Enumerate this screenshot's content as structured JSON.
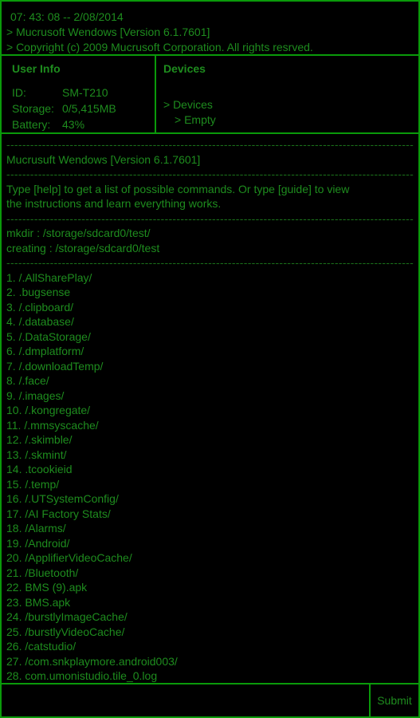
{
  "header": {
    "datetime": "07: 43: 08 -- 2/08/2014",
    "version_line": "> Mucrusoft Wendows [Version 6.1.7601]",
    "copyright_line": "> Copyright (c) 2009 Mucrusoft Corporation. All rights resrved."
  },
  "user_info": {
    "title": "User Info",
    "rows": [
      {
        "key": "ID:",
        "value": "SM-T210"
      },
      {
        "key": "Storage:",
        "value": "0/5,415MB"
      },
      {
        "key": "Battery:",
        "value": "43%"
      }
    ]
  },
  "devices": {
    "title": "Devices",
    "line1": "> Devices",
    "line2": "> Empty"
  },
  "console": {
    "separator": "-----------------------------------------------------------------------------------------------------------------------..",
    "version": "Mucrusuft Wendows [Version 6.1.7601]",
    "help_line1": "Type [help] to get a list of possible commands. Or type [guide] to view",
    "help_line2": "the instructions and learn everything works.",
    "mkdir_line": "mkdir : /storage/sdcard0/test/",
    "creating_line": "creating : /storage/sdcard0/test",
    "files": [
      "1.  /.AllSharePlay/",
      "2.  .bugsense",
      "3.  /.clipboard/",
      "4.  /.database/",
      "5.  /.DataStorage/",
      "6.  /.dmplatform/",
      "7.  /.downloadTemp/",
      "8.  /.face/",
      "9.  /.images/",
      "10.  /.kongregate/",
      "11.  /.mmsyscache/",
      "12.  /.skimble/",
      "13.  /.skmint/",
      "14.  .tcookieid",
      "15.  /.temp/",
      "16.  /.UTSystemConfig/",
      "17.  /AI Factory Stats/",
      "18.  /Alarms/",
      "19.  /Android/",
      "20.  /ApplifierVideoCache/",
      "21.  /Bluetooth/",
      "22.  BMS (9).apk",
      "23.  BMS.apk",
      "24.  /burstlyImageCache/",
      "25.  /burstlyVideoCache/",
      "26.  /catstudio/",
      "27.  /com.snkplaymore.android003/",
      "28.  com.umonistudio.tile_0.log"
    ]
  },
  "input": {
    "value": "",
    "placeholder": ""
  },
  "submit_label": "Submit",
  "colors": {
    "border": "#0a9a0a",
    "text": "#1e8c1e",
    "background": "#000000"
  }
}
